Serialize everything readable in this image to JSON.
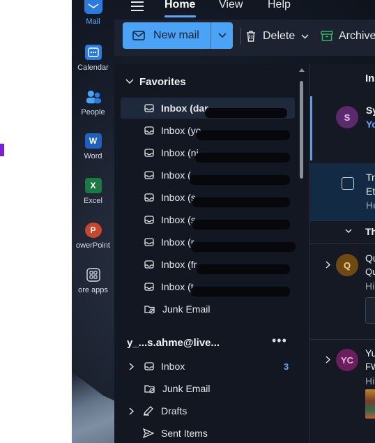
{
  "rail": {
    "items": [
      {
        "label": "Mail",
        "active": true
      },
      {
        "label": "Calendar"
      },
      {
        "label": "People"
      },
      {
        "label": "Word"
      },
      {
        "label": "Excel"
      },
      {
        "label": "owerPoint"
      },
      {
        "label": "ore apps"
      }
    ]
  },
  "topbar": {
    "tabs": [
      "Home",
      "View",
      "Help"
    ]
  },
  "ribbon": {
    "new_mail": "New mail",
    "delete": "Delete",
    "archive": "Archive"
  },
  "favorites": {
    "title": "Favorites",
    "items": [
      {
        "label": "Inbox (dar"
      },
      {
        "label": "Inbox (yo"
      },
      {
        "label": "Inbox (ni"
      },
      {
        "label": "Inbox ("
      },
      {
        "label": "Inbox (s"
      },
      {
        "label": "Inbox (s"
      },
      {
        "label": "Inbox (r"
      },
      {
        "label": "Inbox (fr"
      },
      {
        "label": "Inbox (t"
      },
      {
        "label": "Junk Email"
      }
    ]
  },
  "account": {
    "name": "y_...s.ahme@live...",
    "more": "•••",
    "folders": [
      {
        "label": "Inbox",
        "count": "3"
      },
      {
        "label": "Junk Email"
      },
      {
        "label": "Drafts"
      },
      {
        "label": "Sent Items"
      }
    ]
  },
  "messages": {
    "header": "In",
    "items": [
      {
        "initials": "S",
        "line1": "Sy",
        "line2": "Yo",
        "avatar_color": "#5b2a6e"
      },
      {
        "line1": "Tre",
        "line2": "Eth",
        "line3": "He"
      },
      {
        "group": "Th"
      },
      {
        "initials": "Q",
        "line1": "Qu",
        "line2": "Qu",
        "line3": "Hi",
        "avatar_color": "#6e4a12"
      },
      {
        "initials": "YC",
        "line1": "Yu",
        "line2": "FW",
        "line3": "Hi",
        "avatar_color": "#6a1f5c"
      }
    ]
  },
  "colors": {
    "accent": "#4aa3f5",
    "rail_active": "#5aa9ff"
  }
}
